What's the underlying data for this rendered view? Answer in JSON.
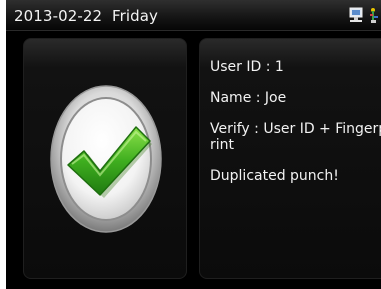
{
  "status_bar": {
    "date": "2013-02-22",
    "weekday": "Friday",
    "icons": [
      "network-icon",
      "usb-icon"
    ]
  },
  "result": {
    "icon": "checkmark-icon",
    "status": "success"
  },
  "info": {
    "user_id": "User ID : 1",
    "name": "Name : Joe",
    "verify": "Verify : User ID + Fingerprint",
    "message": "Duplicated punch!"
  },
  "colors": {
    "check_green": "#3fae1f",
    "background": "#000000",
    "text": "#f2f2f2"
  }
}
